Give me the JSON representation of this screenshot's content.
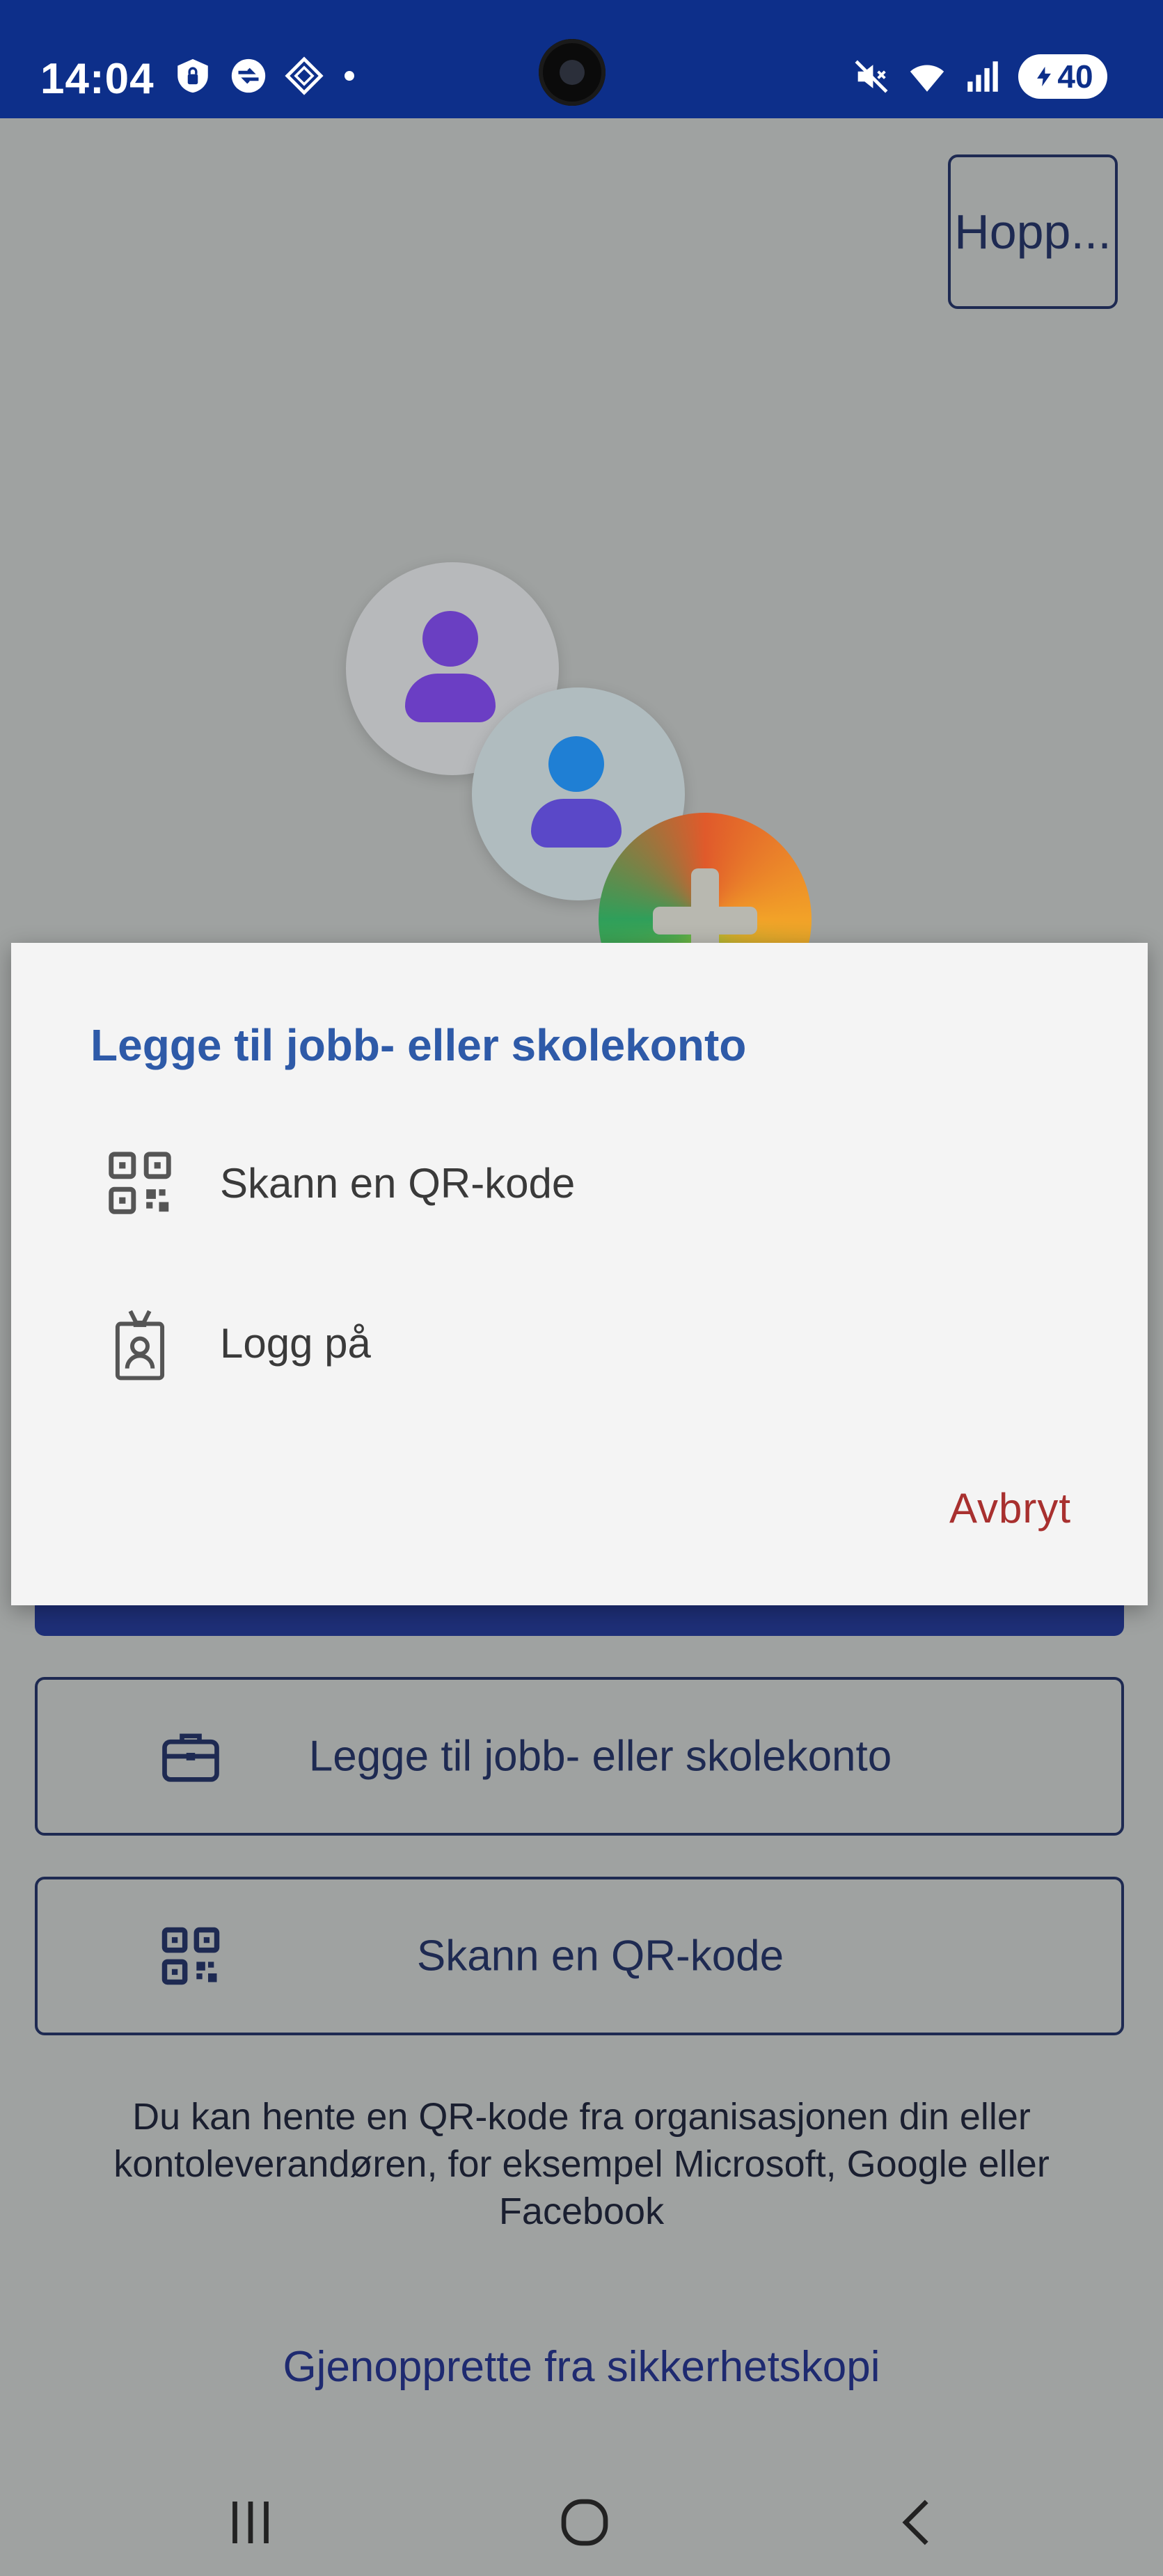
{
  "status_bar": {
    "time": "14:04",
    "battery": "40",
    "left_icons": [
      "lock-icon",
      "app-icon",
      "diamond-icon",
      "dot-icon"
    ],
    "right_icons": [
      "mute-icon",
      "wifi-icon",
      "signal-icon",
      "charging-icon"
    ]
  },
  "header": {
    "skip_label": "Hopp..."
  },
  "dialog": {
    "title": "Legge til jobb- eller skolekonto",
    "items": [
      {
        "icon": "qr-code-icon",
        "label": "Skann en QR-kode"
      },
      {
        "icon": "badge-icon",
        "label": "Logg på"
      }
    ],
    "cancel_label": "Avbryt"
  },
  "main": {
    "buttons": [
      {
        "icon": "briefcase-icon",
        "label": "Legge til jobb- eller skolekonto"
      },
      {
        "icon": "qr-code-icon",
        "label": "Skann en QR-kode"
      }
    ],
    "info_text": "Du kan hente en QR-kode fra organisasjonen din eller kontoleverandøren, for eksempel Microsoft, Google eller Facebook",
    "restore_link": "Gjenopprette fra sikkerhetskopi"
  },
  "nav_bar": {
    "items": [
      "recent-apps-icon",
      "home-icon",
      "back-icon"
    ]
  },
  "colors": {
    "status_bar": "#0d2f8a",
    "dialog_title": "#2e5aa8",
    "cancel": "#a8302f",
    "outline": "#1e2a52"
  }
}
